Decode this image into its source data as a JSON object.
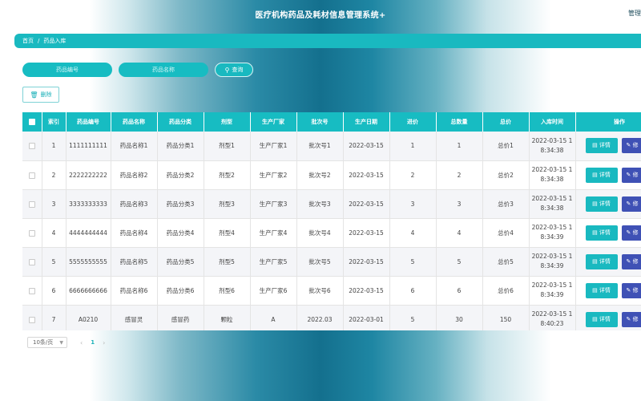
{
  "header": {
    "title": "医疗机构药品及耗材信息管理系统+",
    "admin_label": "管理"
  },
  "breadcrumb": {
    "home": "首页",
    "separator": "/",
    "current": "药品入库"
  },
  "search": {
    "code_placeholder": "药品编号",
    "name_placeholder": "药品名称",
    "button_label": "查询",
    "button_icon": "search-icon"
  },
  "toolbar": {
    "delete_label": "删除",
    "delete_icon": "trash-icon"
  },
  "table": {
    "columns": [
      "索引",
      "药品编号",
      "药品名称",
      "药品分类",
      "剂型",
      "生产厂家",
      "批次号",
      "生产日期",
      "进价",
      "总数量",
      "总价",
      "入库时间",
      "操作"
    ],
    "detail_label": "详情",
    "edit_label": "修",
    "rows": [
      {
        "index": "1",
        "code": "1111111111",
        "name": "药品名称1",
        "category": "药品分类1",
        "form": "剂型1",
        "maker": "生产厂家1",
        "batch": "批次号1",
        "date": "2022-03-15",
        "price": "1",
        "qty": "1",
        "total": "总价1",
        "time1": "2022-03-15 1",
        "time2": "8:34:38"
      },
      {
        "index": "2",
        "code": "2222222222",
        "name": "药品名称2",
        "category": "药品分类2",
        "form": "剂型2",
        "maker": "生产厂家2",
        "batch": "批次号2",
        "date": "2022-03-15",
        "price": "2",
        "qty": "2",
        "total": "总价2",
        "time1": "2022-03-15 1",
        "time2": "8:34:38"
      },
      {
        "index": "3",
        "code": "3333333333",
        "name": "药品名称3",
        "category": "药品分类3",
        "form": "剂型3",
        "maker": "生产厂家3",
        "batch": "批次号3",
        "date": "2022-03-15",
        "price": "3",
        "qty": "3",
        "total": "总价3",
        "time1": "2022-03-15 1",
        "time2": "8:34:38"
      },
      {
        "index": "4",
        "code": "4444444444",
        "name": "药品名称4",
        "category": "药品分类4",
        "form": "剂型4",
        "maker": "生产厂家4",
        "batch": "批次号4",
        "date": "2022-03-15",
        "price": "4",
        "qty": "4",
        "total": "总价4",
        "time1": "2022-03-15 1",
        "time2": "8:34:39"
      },
      {
        "index": "5",
        "code": "5555555555",
        "name": "药品名称5",
        "category": "药品分类5",
        "form": "剂型5",
        "maker": "生产厂家5",
        "batch": "批次号5",
        "date": "2022-03-15",
        "price": "5",
        "qty": "5",
        "total": "总价5",
        "time1": "2022-03-15 1",
        "time2": "8:34:39"
      },
      {
        "index": "6",
        "code": "6666666666",
        "name": "药品名称6",
        "category": "药品分类6",
        "form": "剂型6",
        "maker": "生产厂家6",
        "batch": "批次号6",
        "date": "2022-03-15",
        "price": "6",
        "qty": "6",
        "total": "总价6",
        "time1": "2022-03-15 1",
        "time2": "8:34:39"
      },
      {
        "index": "7",
        "code": "A0210",
        "name": "感冒灵",
        "category": "感冒药",
        "form": "颗粒",
        "maker": "A",
        "batch": "2022.03",
        "date": "2022-03-01",
        "price": "5",
        "qty": "30",
        "total": "150",
        "time1": "2022-03-15 1",
        "time2": "8:40:23"
      }
    ]
  },
  "pagination": {
    "page_size": "10条/页",
    "prev": "‹",
    "current_page": "1",
    "next": "›"
  },
  "colors": {
    "accent": "#17bcc2",
    "edit": "#3f51b5"
  }
}
